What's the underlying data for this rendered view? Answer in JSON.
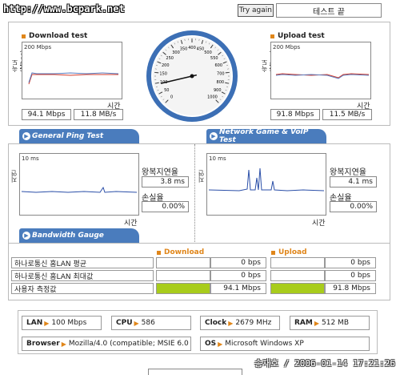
{
  "url": "http://www.bcpark.net",
  "try_again": "Try again",
  "result": "테스트 끝",
  "download": {
    "title": "Download test",
    "ylabel": "속도(Mbps)",
    "scale": "200 Mbps",
    "xlabel": "시간",
    "mbps": "94.1 Mbps",
    "mbs": "11.8 MB/s"
  },
  "upload": {
    "title": "Upload test",
    "ylabel": "속도(Mbps)",
    "scale": "200 Mbps",
    "xlabel": "시간",
    "mbps": "91.8 Mbps",
    "mbs": "11.5 MB/s"
  },
  "gauge": {
    "ticks": [
      "0",
      "50",
      "100",
      "150",
      "200",
      "250",
      "300",
      "350",
      "400",
      "450",
      "500",
      "550",
      "600",
      "700",
      "800",
      "900",
      "1000"
    ],
    "value_mbps": 94.1
  },
  "tabs": {
    "ping": "General Ping Test",
    "game": "Network Game & VoIP Test",
    "bw": "Bandwidth Gauge"
  },
  "ping": {
    "ylabel": "지연(ms)",
    "scale": "10 ms",
    "xlabel": "시간",
    "rtt_label": "왕복지연율",
    "rtt": "3.8 ms",
    "loss_label": "손실율",
    "loss": "0.00%"
  },
  "game": {
    "ylabel": "지연(ms)",
    "scale": "10 ms",
    "xlabel": "시간",
    "rtt_label": "왕복지연율",
    "rtt": "4.1 ms",
    "loss_label": "손실율",
    "loss": "0.00%"
  },
  "bandwidth": {
    "dl_label": "Download",
    "ul_label": "Upload",
    "rows": [
      {
        "label": "하나로통신 홈LAN 평균",
        "dl": "0 bps",
        "ul": "0 bps",
        "dl_frac": 0,
        "ul_frac": 0
      },
      {
        "label": "하나로통신 홈LAN 최대값",
        "dl": "0 bps",
        "ul": "0 bps",
        "dl_frac": 0,
        "ul_frac": 0
      },
      {
        "label": "사용자 측정값",
        "dl": "94.1 Mbps",
        "ul": "91.8 Mbps",
        "dl_frac": 1,
        "ul_frac": 1
      }
    ]
  },
  "sysinfo": {
    "lan_k": "LAN",
    "lan_v": "100 Mbps",
    "cpu_k": "CPU",
    "cpu_v": "586",
    "clock_k": "Clock",
    "clock_v": "2679 MHz",
    "ram_k": "RAM",
    "ram_v": "512 MB",
    "browser_k": "Browser",
    "browser_v": "Mozilla/4.0 (compatible; MSIE 6.0",
    "os_k": "OS",
    "os_v": "Microsoft Windows XP"
  },
  "footer": "송재호 / 2006-01-14 17:21:26",
  "colors": {
    "tab": "#4a7cbd",
    "accent": "#e0861a",
    "bar": "#a8cc1c",
    "gauge_ring": "#3c6fb5"
  }
}
